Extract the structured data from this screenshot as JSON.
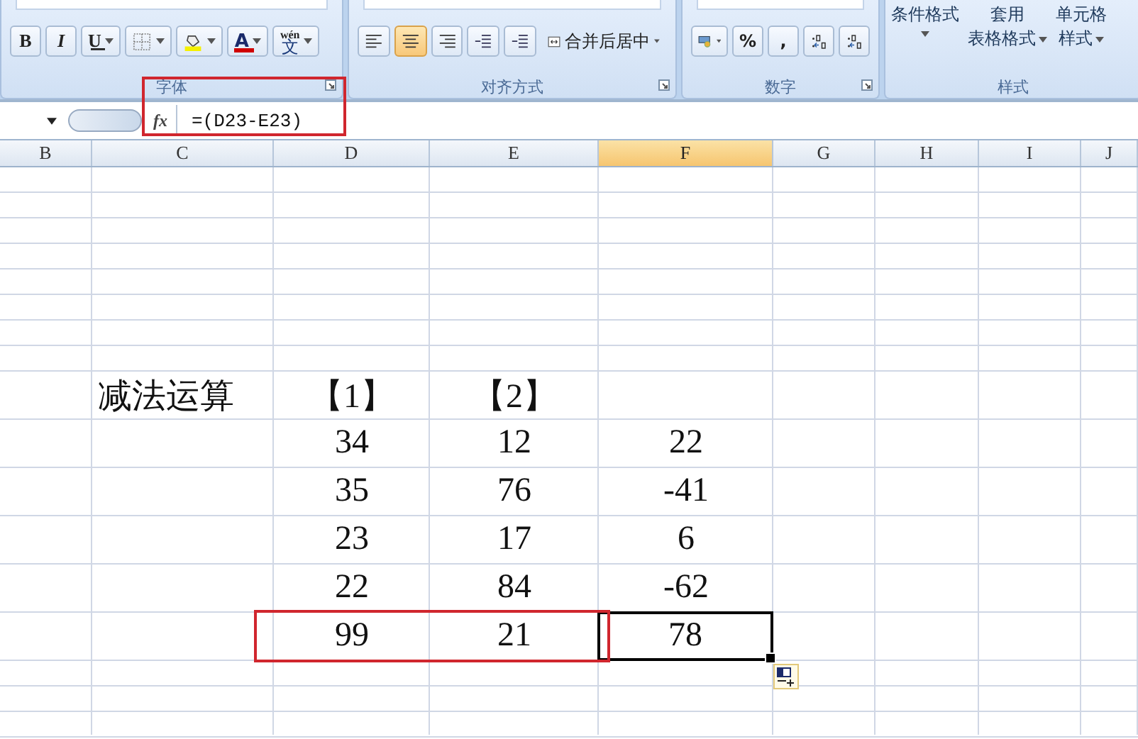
{
  "ribbon": {
    "groups": [
      {
        "kind": "font",
        "label": "字体",
        "buttons": [
          {
            "kind": "bold",
            "text": "B"
          },
          {
            "kind": "italic",
            "text": "I"
          },
          {
            "kind": "underline",
            "text": "U"
          },
          {
            "kind": "borders"
          },
          {
            "kind": "fill-color"
          },
          {
            "kind": "font-color",
            "text": "A"
          },
          {
            "kind": "phonetic",
            "text": "文",
            "ruby": "wén"
          }
        ]
      },
      {
        "kind": "alignment",
        "label": "对齐方式",
        "buttons": [
          {
            "kind": "align-left",
            "selected": false
          },
          {
            "kind": "align-center",
            "selected": true
          },
          {
            "kind": "align-right",
            "selected": false
          },
          {
            "kind": "indent-decrease",
            "selected": false
          },
          {
            "kind": "indent-increase",
            "selected": false
          },
          {
            "kind": "merge",
            "text": "合并后居中",
            "selected": false
          }
        ]
      },
      {
        "kind": "number",
        "label": "数字",
        "buttons": [
          {
            "kind": "currency"
          },
          {
            "kind": "percent",
            "text": "%"
          },
          {
            "kind": "comma",
            "text": ","
          },
          {
            "kind": "decimal-increase"
          },
          {
            "kind": "decimal-decrease"
          }
        ]
      },
      {
        "kind": "styles",
        "label": "样式",
        "buttons": [
          {
            "kind": "large",
            "lines": [
              "条件格式"
            ]
          },
          {
            "kind": "large",
            "lines": [
              "套用",
              "表格格式"
            ]
          },
          {
            "kind": "large",
            "lines": [
              "单元格",
              "样式"
            ]
          }
        ]
      }
    ]
  },
  "formula_bar": {
    "fx": "fx",
    "formula": "=(D23-E23)",
    "boxed": true
  },
  "columns": [
    {
      "label": "B",
      "selected": false
    },
    {
      "label": "C",
      "selected": false
    },
    {
      "label": "D",
      "selected": false
    },
    {
      "label": "E",
      "selected": false
    },
    {
      "label": "F",
      "selected": true
    },
    {
      "label": "G",
      "selected": false
    },
    {
      "label": "H",
      "selected": false
    },
    {
      "label": "I",
      "selected": false
    },
    {
      "label": "J",
      "selected": false
    }
  ],
  "table": {
    "title": "减法运算",
    "headers": [
      "【1】",
      "【2】"
    ],
    "rows": [
      {
        "cells": [
          {
            "text": "34",
            "active": false,
            "boxed": false
          },
          {
            "text": "12",
            "active": false,
            "boxed": false
          },
          {
            "text": "22",
            "active": false,
            "boxed": false
          }
        ]
      },
      {
        "cells": [
          {
            "text": "35",
            "active": false,
            "boxed": false
          },
          {
            "text": "76",
            "active": false,
            "boxed": false
          },
          {
            "text": "-41",
            "active": false,
            "boxed": false
          }
        ]
      },
      {
        "cells": [
          {
            "text": "23",
            "active": false,
            "boxed": false
          },
          {
            "text": "17",
            "active": false,
            "boxed": false
          },
          {
            "text": "6",
            "active": false,
            "boxed": false
          }
        ]
      },
      {
        "cells": [
          {
            "text": "22",
            "active": false,
            "boxed": false
          },
          {
            "text": "84",
            "active": false,
            "boxed": false
          },
          {
            "text": "-62",
            "active": false,
            "boxed": false
          }
        ]
      },
      {
        "cells": [
          {
            "text": "99",
            "active": false,
            "boxed": true
          },
          {
            "text": "21",
            "active": false,
            "boxed": true
          },
          {
            "text": "78",
            "active": true,
            "boxed": false
          }
        ]
      }
    ]
  }
}
